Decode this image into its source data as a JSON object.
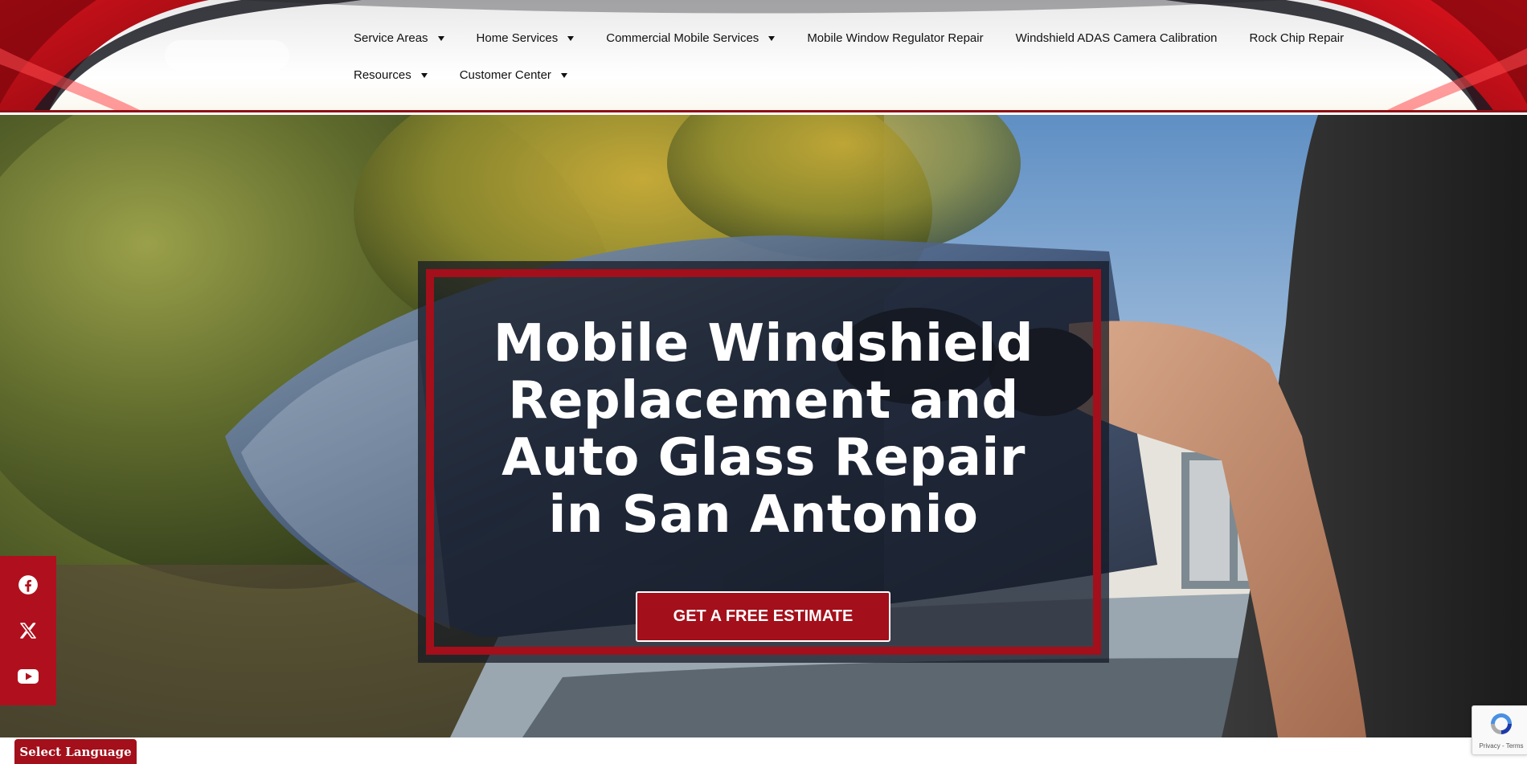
{
  "nav": {
    "row1": [
      {
        "label": "Service Areas",
        "dropdown": true
      },
      {
        "label": "Home Services",
        "dropdown": true
      },
      {
        "label": "Commercial Mobile Services",
        "dropdown": true
      },
      {
        "label": "Mobile Window Regulator Repair",
        "dropdown": false
      },
      {
        "label": "Windshield ADAS Camera Calibration",
        "dropdown": false
      },
      {
        "label": "Rock Chip Repair",
        "dropdown": false
      }
    ],
    "row2": [
      {
        "label": "Resources",
        "dropdown": true
      },
      {
        "label": "Customer Center",
        "dropdown": true
      }
    ]
  },
  "hero": {
    "title_lines": [
      "Mobile Windshield",
      "Replacement and",
      "Auto Glass Repair",
      "in San Antonio"
    ],
    "cta_label": "GET A FREE ESTIMATE"
  },
  "social": [
    {
      "icon": "facebook-icon"
    },
    {
      "icon": "x-twitter-icon"
    },
    {
      "icon": "youtube-icon"
    }
  ],
  "language": {
    "label": "Select Language"
  },
  "recaptcha": {
    "privacy": "Privacy",
    "separator": " - ",
    "terms": "Terms"
  },
  "colors": {
    "brand_red": "#a30f1a",
    "hero_overlay": "#141822",
    "text_dark": "#111111"
  }
}
